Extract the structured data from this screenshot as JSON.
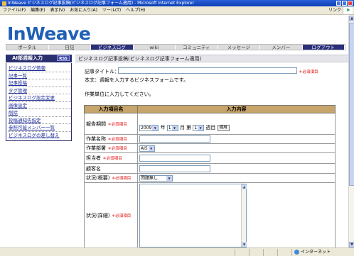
{
  "window": {
    "title": "InWeave ビジネスログ記事投稿(ビジネスログ記事フォーム適用) - Microsoft Internet Explorer",
    "menu": [
      "ファイル(F)",
      "編集(E)",
      "表示(V)",
      "お気に入り(A)",
      "ツール(T)",
      "ヘルプ(H)"
    ],
    "links_label": "リンク",
    "status_zone": "インターネット"
  },
  "site": {
    "logo": "InWeave",
    "nav": [
      "ポータル",
      "日記",
      "ビジネスログ",
      "wiki",
      "コミュニティ",
      "メッセージ",
      "メンバー",
      "ログアウト"
    ]
  },
  "sidebar": {
    "header": "AI部週報入力",
    "rss": "RSS",
    "items": [
      "ビジネスログ情報",
      "記事一覧",
      "記事投稿",
      "タグ管理",
      "ビジネスログ設定変更",
      "画像設定",
      "削除",
      "投稿通知先指定",
      "参照可能メンバー一覧",
      "ビジネスログの差し替え"
    ]
  },
  "main": {
    "page_title": "ビジネスログ記事投稿(ビジネスログ記事フォーム適用)",
    "title_label": "記事タイトル：",
    "required": "＊必須項目",
    "desc1": "本文：週報を入力するビジネスフォームです。",
    "desc2": "作業単位に入力してください。",
    "table": {
      "col1": "入力項目名",
      "col2": "入力内容",
      "period_label": "報告期間",
      "year_value": "2009",
      "year_unit": "年",
      "month_value": "1",
      "month_unit": "月",
      "week_prefix": "第",
      "week_value": "1",
      "week_unit": "週目",
      "apply_button": "適用",
      "work_name_label": "作業名称",
      "work_dept_label": "作業部署",
      "dept_value": "AI5",
      "person_label": "担当者",
      "customer_label": "顧客名",
      "status_label": "状況(概要)",
      "status_value": "問題無し",
      "detail_label": "状況(詳細)"
    }
  }
}
